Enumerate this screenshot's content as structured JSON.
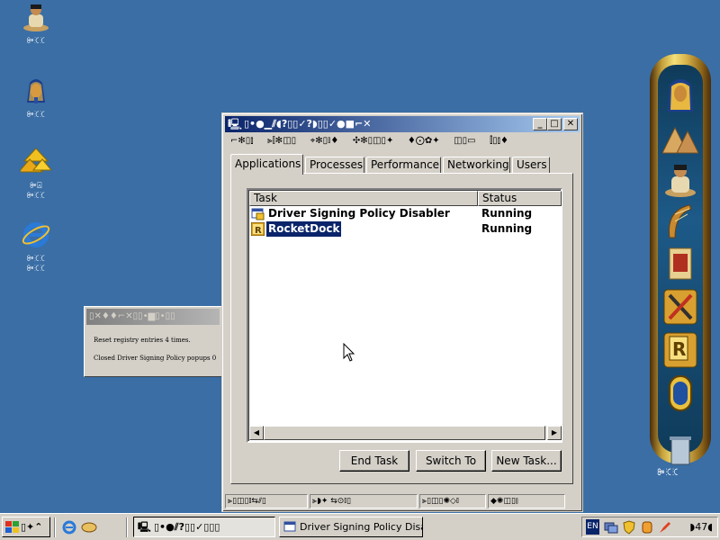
{
  "desktop": {
    "icons": [
      {
        "label": "ꔼꕿꕿ",
        "icon": "seated-scribe-icon"
      },
      {
        "label": "ꔼꕿꕿ",
        "icon": "pharaoh-mask-icon"
      },
      {
        "label": "ꔼ⍓",
        "label2": "ꔼꕿꕿ",
        "icon": "network-pyramid-icon"
      },
      {
        "label": "ꔼꕿꕿ",
        "label2": "ꔼꕿꕿ",
        "icon": "internet-explorer-icon"
      }
    ]
  },
  "bg_window": {
    "title": "▯✕♦♦⌐✕▯▯•▆▯•▯▯",
    "line1": "Reset registry entries 4 times.",
    "line2": "Closed Driver Signing Policy popups 0"
  },
  "task_manager": {
    "title": "▯•●▁⫽◖?▯▯✓?◗▯▯✓●■⌐✕",
    "controls": {
      "minimize": "_",
      "maximize": "□",
      "close": "✕"
    },
    "menu": [
      "⌐✻▯⫾",
      "⫸⫿✻◫▯",
      "⌖✻▯⫾♦",
      "✣✻▯◫▯✦",
      "♦⨀✿✦",
      "◫▯▭",
      "⫿▯⫾♦"
    ],
    "tabs": [
      "Applications",
      "Processes",
      "Performance",
      "Networking",
      "Users"
    ],
    "columns": {
      "task": "Task",
      "status": "Status"
    },
    "rows": [
      {
        "task": "Driver Signing Policy Disabler",
        "status": "Running",
        "icon": "application-icon"
      },
      {
        "task": "RocketDock",
        "status": "Running",
        "icon": "rocketdock-icon"
      }
    ],
    "buttons": {
      "end_task": "End Task",
      "switch_to": "Switch To",
      "new_task": "New Task..."
    },
    "statusbar": [
      "⫸▯◫▯⫾⇆⫽▯",
      "⫸◗✦ ⇆⊙⫾▯",
      "⫸▯◫▯✺◇⫾",
      "◆✺◫▯⫾"
    ]
  },
  "dock": {
    "label": "ꔼꕿꕿ",
    "items": [
      "pharaoh-mask-icon",
      "pyramids-icon",
      "seated-scribe-icon",
      "harp-icon",
      "book-icon",
      "tools-icon",
      "rocketdock-settings-icon",
      "cartouche-icon",
      "recycle-bin-icon"
    ]
  },
  "taskbar": {
    "start_label": "▯✦⌃",
    "tasks": [
      {
        "label": "▯•●⫽?▯▯✓▯▯▯",
        "active": true
      },
      {
        "label": "Driver Signing Policy Disa...",
        "active": false
      }
    ],
    "tray": {
      "lang": "EN",
      "time": "◗47◖"
    }
  }
}
